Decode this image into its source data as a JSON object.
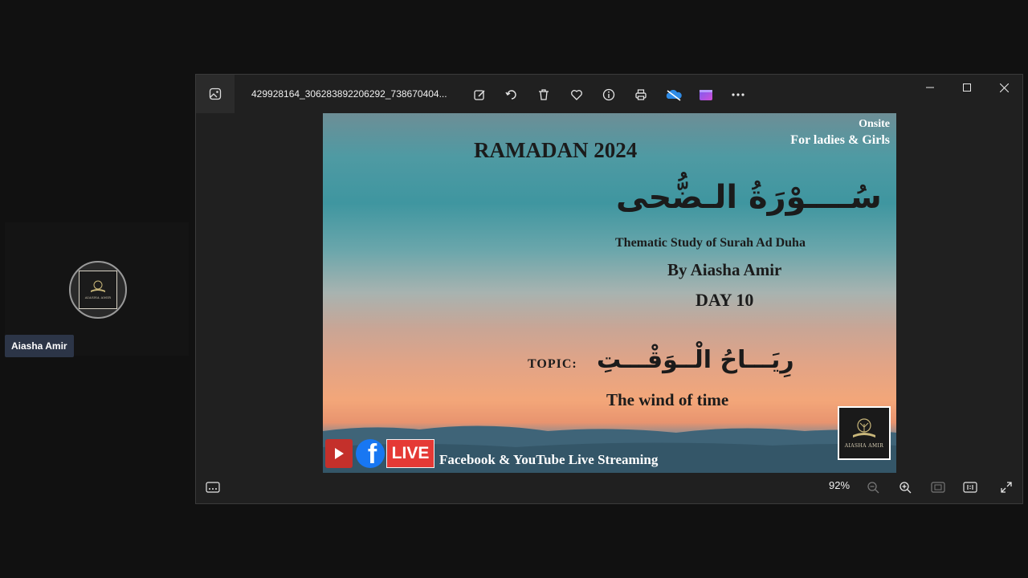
{
  "participant": {
    "name": "Aiasha Amir",
    "avatar_text": "AIASHA AMIR"
  },
  "window": {
    "filename": "429928164_306283892206292_738670404...",
    "toolbar": [
      "edit-icon",
      "rotate-icon",
      "delete-icon",
      "favorite-icon",
      "info-icon",
      "print-icon",
      "onedrive-icon",
      "clipchamp-icon",
      "more-icon"
    ],
    "controls": [
      "minimize",
      "maximize",
      "close"
    ],
    "zoom": "92%"
  },
  "poster": {
    "onsite": "Onsite",
    "audience": "For ladies & Girls",
    "title": "RAMADAN 2024",
    "surah_arabic": "سُــــوْرَةُ الـضُّحى",
    "thematic": "Thematic Study of Surah Ad Duha",
    "byline": "By Aiasha Amir",
    "day": "DAY 10",
    "topic_label": "TOPIC:",
    "topic_arabic": "رِيَـــاحُ الْــوَقْـــتِ",
    "topic_english": "The wind of time",
    "live_badge": "LIVE",
    "facebook_glyph": "f",
    "streaming": "Facebook & YouTube Live Streaming",
    "logo_text": "AIASHA AMIR"
  }
}
